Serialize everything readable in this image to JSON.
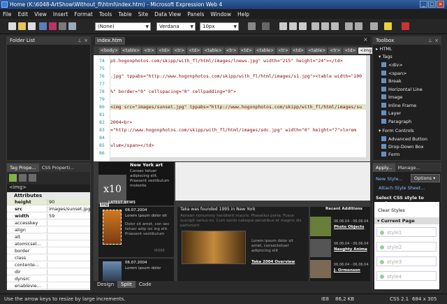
{
  "window": {
    "title": "Home (K:\\6048-ArtShow\\Without_fl\\html\\index.htm) - Microsoft Expression Web 4",
    "min": "_",
    "max": "□",
    "close": "×"
  },
  "menu": [
    "File",
    "Edit",
    "View",
    "Insert",
    "Format",
    "Tools",
    "Table",
    "Site",
    "Data View",
    "Panels",
    "Window",
    "Help"
  ],
  "toolbar": {
    "style_select": "(None)",
    "font_select": "Verdana",
    "size_select": "10px"
  },
  "folder_list": {
    "title": "Folder List"
  },
  "tag_panel": {
    "tabs": [
      "Tag Prope...",
      "CSS Properti..."
    ],
    "tag": "<img>",
    "section": "Attributes",
    "rows": [
      {
        "name": "height",
        "value": "90",
        "bold": true
      },
      {
        "name": "src",
        "value": "images/sunset.jpg",
        "bold": true
      },
      {
        "name": "width",
        "value": "59",
        "bold": true
      },
      {
        "name": "accesskey",
        "value": ""
      },
      {
        "name": "align",
        "value": ""
      },
      {
        "name": "alt",
        "value": ""
      },
      {
        "name": "atomicsel...",
        "value": ""
      },
      {
        "name": "border",
        "value": ""
      },
      {
        "name": "class",
        "value": ""
      },
      {
        "name": "contente...",
        "value": ""
      },
      {
        "name": "dir",
        "value": ""
      },
      {
        "name": "dynsrc",
        "value": ""
      },
      {
        "name": "enablevie...",
        "value": ""
      }
    ]
  },
  "document": {
    "tab": "index.htm",
    "crumbs": [
      "<body>",
      "<table>",
      "<tr>",
      "<td>",
      "<tr>",
      "<td>",
      "<table>",
      "<tr>",
      "<td>",
      "<table>",
      "<tr>",
      "<td>",
      "<table>",
      "<tr>",
      "<td>",
      "<img>"
    ]
  },
  "code_lines": [
    {
      "n": "74",
      "text": "pS.hogonphotos.com/skipp/with_fl/html/images/lnews.jpg\" width=\"215\" height=\"24\"></td>"
    },
    {
      "n": "75",
      "text": ""
    },
    {
      "n": "76",
      "text": ".jpg\" tppabs=\"http://www.hogonphotos.com/skipp/with_fl/html/images/s1.jpg\"><table width=\"100"
    },
    {
      "n": "77",
      "text": ""
    },
    {
      "n": "78",
      "text": "%\" border=\"0\" cellspacing=\"0\" cellpadding=\"0\">"
    },
    {
      "n": "79",
      "text": ""
    },
    {
      "n": "80",
      "text": "<img src=\"images/sunset.jpg\" tppabs=\"http://www.hogonphotos.com/skipp/with_fl/html/images/su"
    },
    {
      "n": "81",
      "text": ""
    },
    {
      "n": "82",
      "text": "2004<br>"
    },
    {
      "n": "83",
      "text": "=\"http://www.hogonphotos.com/skipp/with_fl/html/images/sdc.jpg\" width=\"0\" height=\"7\">lorem"
    },
    {
      "n": "84",
      "text": ""
    },
    {
      "n": "85",
      "text": "ulum</span></td>"
    },
    {
      "n": "86",
      "text": ""
    }
  ],
  "design": {
    "ny_title": "New York art",
    "ny_text": "Consec tetuer adipiscing elit. Praesent vestibulum molestie",
    "logo": "x10",
    "latest": "LATEST NEWS",
    "img_tag": "img",
    "news_date": "06.07.2004",
    "news_title": "Lorem ipsum dolor sit",
    "news_text": "Dolor sit amet, con sec tetuer adip isc ing elit. Praesent vestibulum",
    "more": "MORE",
    "news2_date": "06.07.2004",
    "news2_text": "Lorem ipsum dolor",
    "main_head": "Taka was founded 1995 in New York",
    "main_text": "Aenean nonummy hendrerit mauris. Phasellus porta. Fusce suscipit varius mi. Cum sociis natoque penatibus et magnis dis parturient",
    "main_cap": "Lorem ipsum dolor sit amet, consectetuer adipiscing elit",
    "overview": "Taka 2004 Overview",
    "recent": "Recent Additions",
    "r1_date": "06.06.04 - 06.06.04",
    "r1_title": "Photo Objects",
    "r2_date": "06.06.04 - 06.06.04",
    "r2_title": "Naughty Anima",
    "r3_date": "06.06.04 - 06.06.04",
    "r3_title": "J. Ormonson"
  },
  "mode_tabs": [
    "Design",
    "Split",
    "Code"
  ],
  "toolbox": {
    "title": "Toolbox",
    "html": "HTML",
    "tags": "Tags",
    "items": [
      "<div>",
      "<span>",
      "Break",
      "Horizontal Line",
      "Image",
      "Inline Frame",
      "Layer",
      "Paragraph"
    ],
    "form": "Form Controls",
    "form_items": [
      "Advanced Button",
      "Drop-Down Box",
      "Form"
    ]
  },
  "apply": {
    "tabs": [
      "Apply...",
      "Manage..."
    ],
    "new_style": "New Style...",
    "options": "Options",
    "attach": "Attach Style Sheet...",
    "select_label": "Select CSS style to apply:",
    "clear": "Clear Styles",
    "current": "Current Page",
    "styles": [
      "style1",
      "style2",
      "style3",
      "style4"
    ]
  },
  "status": {
    "hint": "Use the arrow keys to resize by large increments.",
    "ie": "IE8",
    "size": "86,2 KB",
    "css": "CSS 2.1",
    "dims": "684 x 305"
  }
}
